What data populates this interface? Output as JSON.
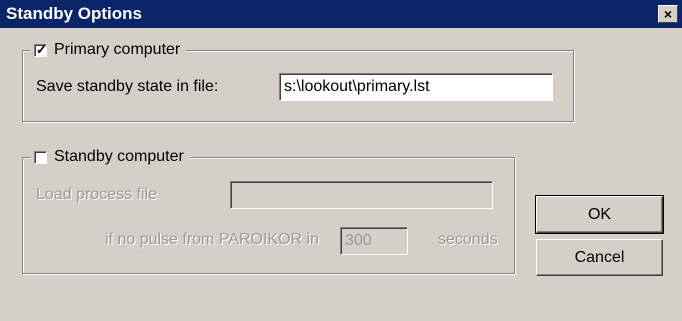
{
  "window": {
    "title": "Standby Options",
    "close_glyph": "×"
  },
  "primary": {
    "checkbox_label": "Primary computer",
    "checked": true,
    "check_glyph": "✓",
    "save_label": "Save standby state in file:",
    "save_value": "s:\\lookout\\primary.lst"
  },
  "standby": {
    "checkbox_label": "Standby computer",
    "checked": false,
    "load_label": "Load process file",
    "load_value": "",
    "pulse_prefix": "if no pulse from PAROIKOR in",
    "pulse_value": "300",
    "pulse_suffix": "seconds"
  },
  "buttons": {
    "ok": "OK",
    "cancel": "Cancel"
  },
  "colors": {
    "titlebar": "#0a246a",
    "face": "#d4d0c8",
    "disabled_text": "#9a9a9a"
  }
}
